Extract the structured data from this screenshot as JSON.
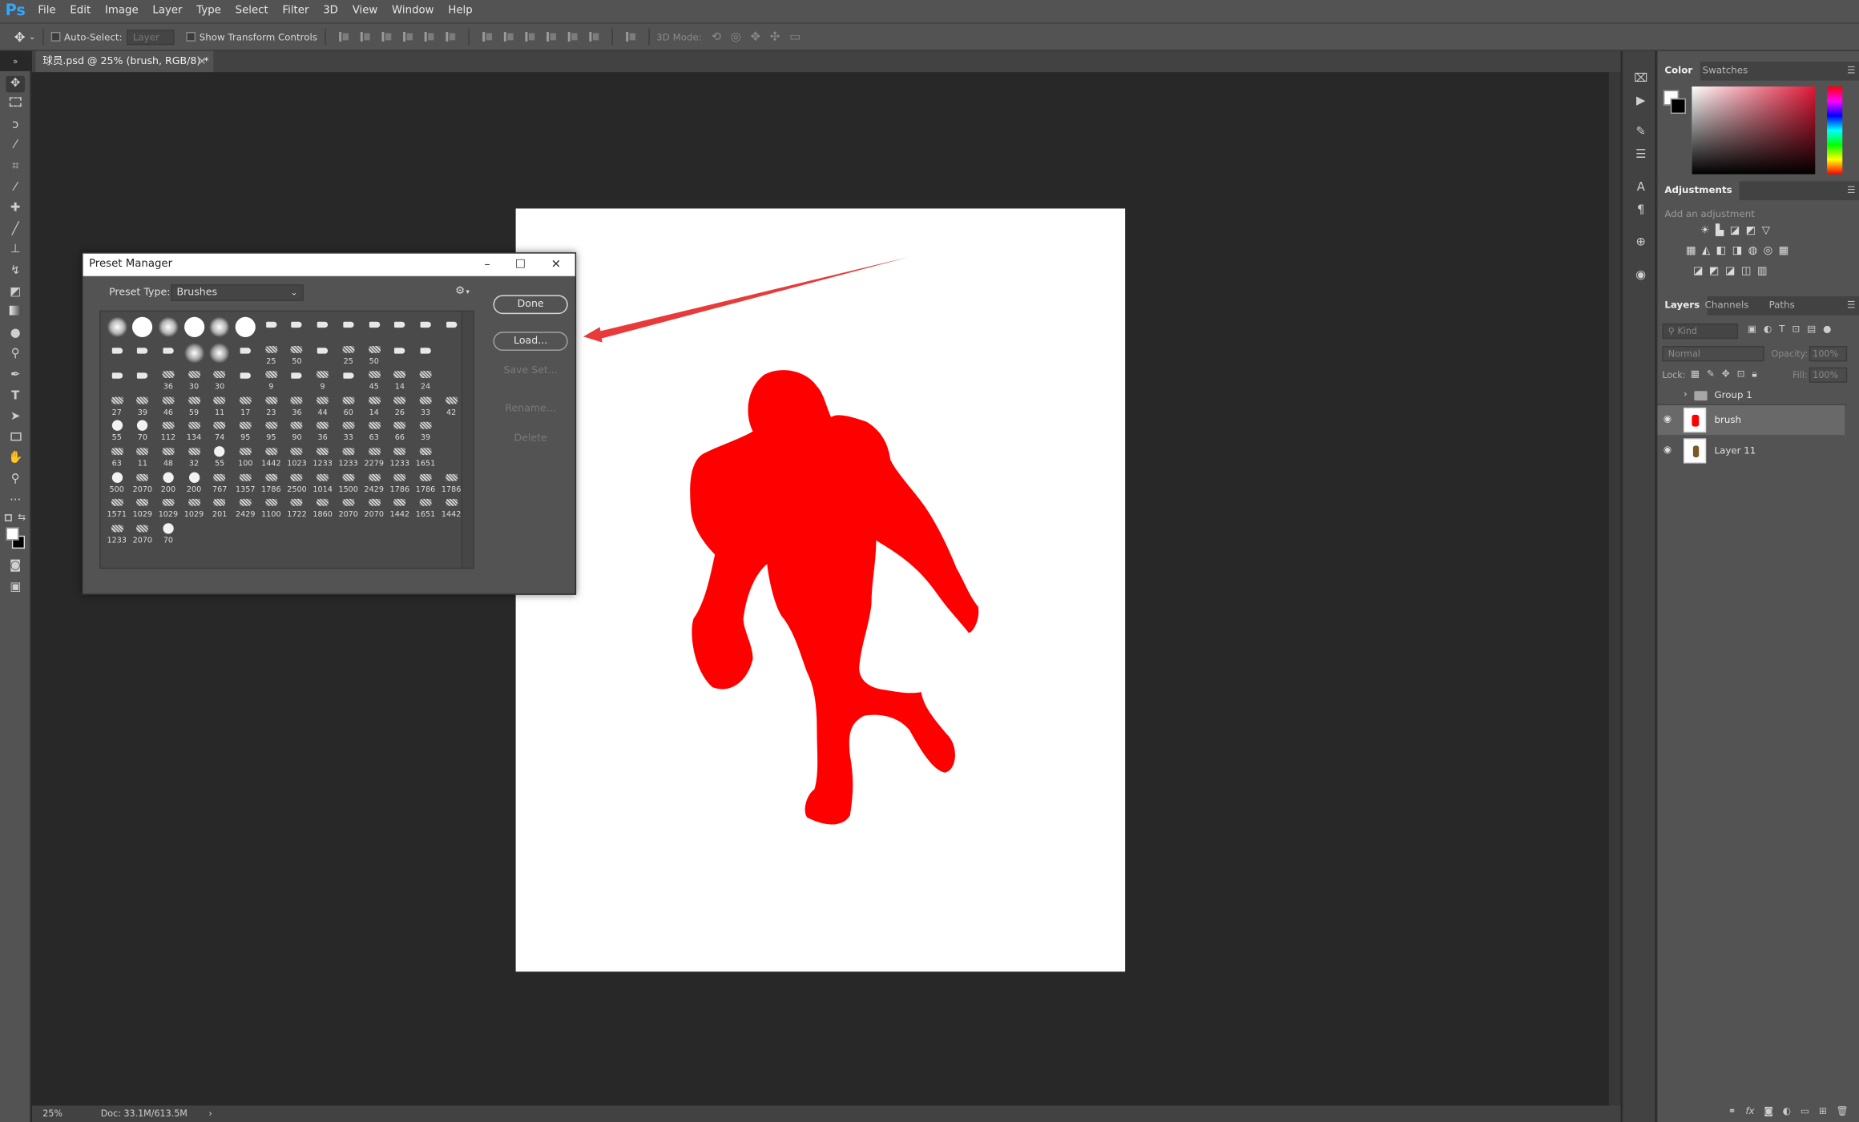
{
  "app": {
    "logo": "Ps"
  },
  "menu": [
    "File",
    "Edit",
    "Image",
    "Layer",
    "Type",
    "Select",
    "Filter",
    "3D",
    "View",
    "Window",
    "Help"
  ],
  "options": {
    "auto_select_label": "Auto-Select:",
    "auto_select_value": "Layer",
    "show_transform_label": "Show Transform Controls",
    "mode_3d_label": "3D Mode:"
  },
  "document": {
    "tab_title": "球员.psd @ 25% (brush, RGB/8) *",
    "tab_close": "×"
  },
  "status": {
    "zoom": "25%",
    "doc_size": "Doc: 33.1M/613.5M",
    "arrow": "›"
  },
  "dialog": {
    "title": "Preset Manager",
    "preset_type_label": "Preset Type:",
    "preset_type_value": "Brushes",
    "buttons": {
      "done": "Done",
      "load": "Load...",
      "save_set": "Save Set...",
      "rename": "Rename...",
      "delete": "Delete"
    },
    "brush_rows": [
      [
        "",
        "",
        "",
        "",
        "",
        "",
        "",
        "",
        "",
        "",
        "",
        "",
        "",
        ""
      ],
      [
        "",
        "",
        "",
        "",
        "",
        "",
        "25",
        "50",
        "",
        "25",
        "50",
        "",
        ""
      ],
      [
        "",
        "",
        "36",
        "30",
        "30",
        "",
        "9",
        "",
        "9",
        "",
        "45",
        "14",
        "24"
      ],
      [
        "27",
        "39",
        "46",
        "59",
        "11",
        "17",
        "23",
        "36",
        "44",
        "60",
        "14",
        "26",
        "33",
        "42"
      ],
      [
        "55",
        "70",
        "112",
        "134",
        "74",
        "95",
        "95",
        "90",
        "36",
        "33",
        "63",
        "66",
        "39"
      ],
      [
        "63",
        "11",
        "48",
        "32",
        "55",
        "100",
        "1442",
        "1023",
        "1233",
        "1233",
        "2279",
        "1233",
        "1651"
      ],
      [
        "500",
        "2070",
        "200",
        "200",
        "767",
        "1357",
        "1786",
        "2500",
        "1014",
        "1500",
        "2429",
        "1786",
        "1786",
        "1786"
      ],
      [
        "1571",
        "1029",
        "1029",
        "1029",
        "201",
        "2429",
        "1100",
        "1722",
        "1860",
        "2070",
        "2070",
        "1442",
        "1651",
        "1442"
      ],
      [
        "1233",
        "2070",
        "70"
      ]
    ]
  },
  "panels": {
    "color_tabs": [
      "Color",
      "Swatches"
    ],
    "adjustments_tab": "Adjustments",
    "add_adjustment": "Add an adjustment",
    "layers_tabs": [
      "Layers",
      "Channels",
      "Paths"
    ],
    "kind_label": "Kind",
    "blend_mode": "Normal",
    "opacity_label": "Opacity:",
    "opacity_value": "100%",
    "lock_label": "Lock:",
    "fill_label": "Fill:",
    "fill_value": "100%",
    "layers": [
      {
        "name": "Group 1",
        "type": "group"
      },
      {
        "name": "brush",
        "type": "layer",
        "selected": true
      },
      {
        "name": "Layer 11",
        "type": "layer"
      }
    ],
    "footer_fx": "fx"
  },
  "colors": {
    "accent": "#31a8ff",
    "silhouette": "#ff0000",
    "chrome": "#535353",
    "canvas_bg": "#282828"
  }
}
